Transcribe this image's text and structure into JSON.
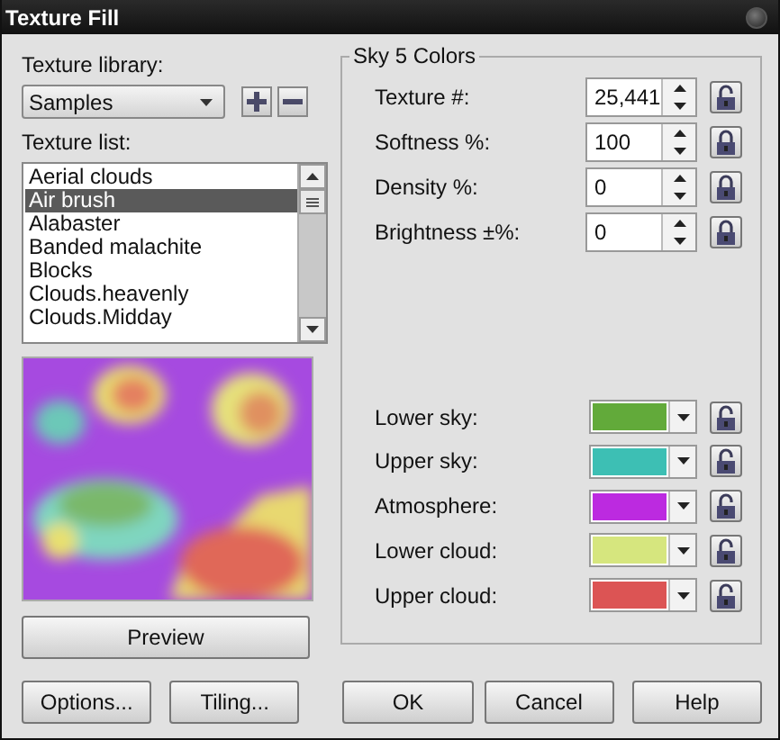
{
  "window": {
    "title": "Texture Fill"
  },
  "library": {
    "label": "Texture library:",
    "value": "Samples"
  },
  "texture_list": {
    "label": "Texture list:",
    "items": [
      {
        "label": "Aerial clouds",
        "selected": false
      },
      {
        "label": "Air brush",
        "selected": true
      },
      {
        "label": "Alabaster",
        "selected": false
      },
      {
        "label": "Banded malachite",
        "selected": false
      },
      {
        "label": "Blocks",
        "selected": false
      },
      {
        "label": "Clouds.heavenly",
        "selected": false
      },
      {
        "label": "Clouds.Midday",
        "selected": false
      }
    ]
  },
  "preview": {
    "kind": "picture",
    "button": "Preview"
  },
  "group": {
    "title": "Sky 5 Colors",
    "numbers": [
      {
        "label": "Texture #:",
        "value": "25,441",
        "locked": false
      },
      {
        "label": "Softness %:",
        "value": "100",
        "locked": true
      },
      {
        "label": "Density %:",
        "value": "0",
        "locked": true
      },
      {
        "label": "Brightness ±%:",
        "value": "0",
        "locked": true
      }
    ],
    "colors": [
      {
        "label": "Lower sky:",
        "color": "#62aa3a",
        "locked": false
      },
      {
        "label": "Upper sky:",
        "color": "#3dbfb4",
        "locked": false
      },
      {
        "label": "Atmosphere:",
        "color": "#bc2ae0",
        "locked": false
      },
      {
        "label": "Lower cloud:",
        "color": "#d6e67e",
        "locked": false
      },
      {
        "label": "Upper cloud:",
        "color": "#dc5454",
        "locked": false
      }
    ]
  },
  "buttons": [
    {
      "label": "Options..."
    },
    {
      "label": "Tiling..."
    },
    {
      "label": "OK"
    },
    {
      "label": "Cancel"
    },
    {
      "label": "Help"
    }
  ]
}
